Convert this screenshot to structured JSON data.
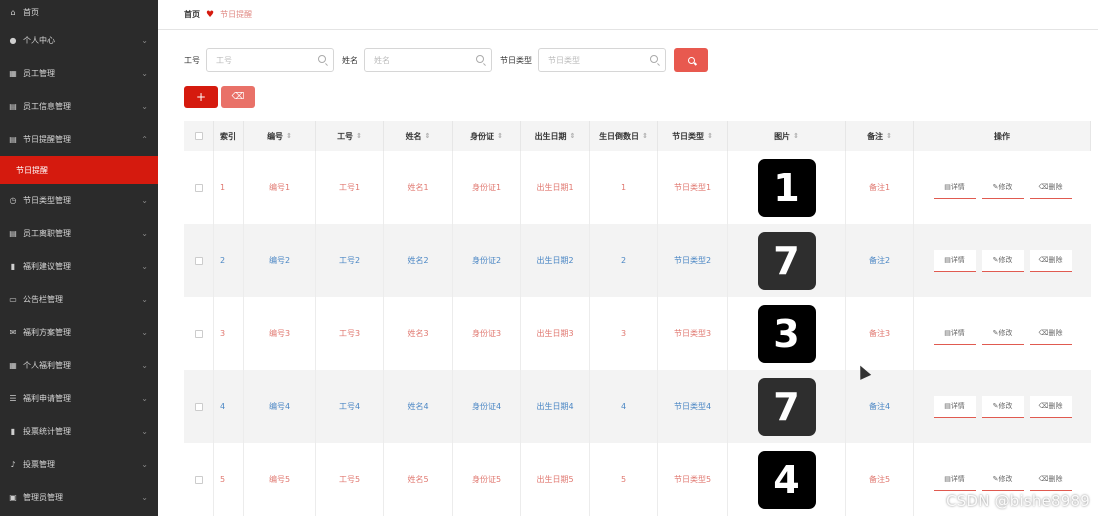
{
  "sidebar": {
    "items": [
      {
        "label": "首页",
        "icon": "home-icon",
        "glyph": "⌂"
      },
      {
        "label": "个人中心",
        "icon": "user-icon",
        "glyph": "●"
      },
      {
        "label": "员工管理",
        "icon": "grid-icon",
        "glyph": "▦"
      },
      {
        "label": "员工信息管理",
        "icon": "doc-icon",
        "glyph": "▤"
      },
      {
        "label": "节日提醒管理",
        "icon": "doc-icon",
        "glyph": "▤"
      },
      {
        "label": "节日类型管理",
        "icon": "clock-icon",
        "glyph": "◷"
      },
      {
        "label": "员工离职管理",
        "icon": "doc-icon",
        "glyph": "▤"
      },
      {
        "label": "福利建议管理",
        "icon": "bar-chart-icon",
        "glyph": "▮"
      },
      {
        "label": "公告栏管理",
        "icon": "stack-icon",
        "glyph": "▭"
      },
      {
        "label": "福利方案管理",
        "icon": "mail-icon",
        "glyph": "✉"
      },
      {
        "label": "个人福利管理",
        "icon": "apps-icon",
        "glyph": "▦"
      },
      {
        "label": "福利申请管理",
        "icon": "sliders-icon",
        "glyph": "☰"
      },
      {
        "label": "投票统计管理",
        "icon": "chart-icon",
        "glyph": "▮"
      },
      {
        "label": "投票管理",
        "icon": "mic-icon",
        "glyph": "♪"
      },
      {
        "label": "管理员管理",
        "icon": "card-icon",
        "glyph": "▣"
      }
    ],
    "active_sub": "节日提醒"
  },
  "breadcrumb": {
    "home": "首页",
    "current": "节日提醒"
  },
  "search": {
    "gonghao_label": "工号",
    "gonghao_placeholder": "工号",
    "xingming_label": "姓名",
    "xingming_placeholder": "姓名",
    "leixing_label": "节日类型",
    "leixing_placeholder": "节日类型"
  },
  "buttons": {
    "add": "+",
    "delete": "🗑"
  },
  "table": {
    "headers": [
      "索引",
      "编号",
      "工号",
      "姓名",
      "身份证",
      "出生日期",
      "生日倒数日",
      "节日类型",
      "图片",
      "备注",
      "操作"
    ],
    "sort_glyph": "⇕",
    "ops": [
      "详情",
      "修改",
      "删除"
    ],
    "rows": [
      {
        "index": "1",
        "bianhao": "编号1",
        "gonghao": "工号1",
        "xingming": "姓名1",
        "shenfenzheng": "身份证1",
        "chusheng": "出生日期1",
        "daoshu": "1",
        "leixing": "节日类型1",
        "tupian": "1",
        "beizhu": "备注1"
      },
      {
        "index": "2",
        "bianhao": "编号2",
        "gonghao": "工号2",
        "xingming": "姓名2",
        "shenfenzheng": "身份证2",
        "chusheng": "出生日期2",
        "daoshu": "2",
        "leixing": "节日类型2",
        "tupian": "7",
        "beizhu": "备注2"
      },
      {
        "index": "3",
        "bianhao": "编号3",
        "gonghao": "工号3",
        "xingming": "姓名3",
        "shenfenzheng": "身份证3",
        "chusheng": "出生日期3",
        "daoshu": "3",
        "leixing": "节日类型3",
        "tupian": "3",
        "beizhu": "备注3"
      },
      {
        "index": "4",
        "bianhao": "编号4",
        "gonghao": "工号4",
        "xingming": "姓名4",
        "shenfenzheng": "身份证4",
        "chusheng": "出生日期4",
        "daoshu": "4",
        "leixing": "节日类型4",
        "tupian": "7",
        "beizhu": "备注4"
      },
      {
        "index": "5",
        "bianhao": "编号5",
        "gonghao": "工号5",
        "xingming": "姓名5",
        "shenfenzheng": "身份证5",
        "chusheng": "出生日期5",
        "daoshu": "5",
        "leixing": "节日类型5",
        "tupian": "4",
        "beizhu": "备注5"
      }
    ]
  },
  "watermark": "CSDN @bishe8989",
  "colors": {
    "accent": "#d51a0e",
    "row_text_odd": "#e07870",
    "row_text_even": "#4a86c4",
    "sidebar_bg": "#2b2b2b"
  }
}
